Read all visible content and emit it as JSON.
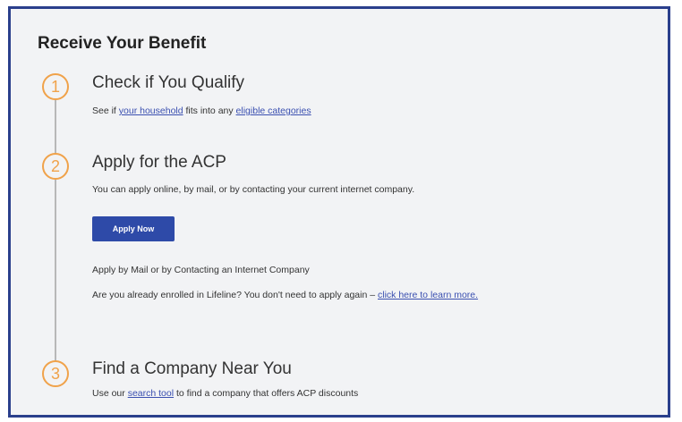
{
  "section": {
    "title": "Receive Your Benefit"
  },
  "steps": [
    {
      "number": "1",
      "title": "Check if You Qualify",
      "text_before": "See if ",
      "link1": "your household",
      "text_middle": " fits into any ",
      "link2": "eligible categories"
    },
    {
      "number": "2",
      "title": "Apply for the ACP",
      "description": "You can apply online, by mail, or by contacting your current internet company.",
      "button_label": "Apply Now",
      "mail_text": "Apply by Mail or by Contacting an Internet Company",
      "lifeline_text": "Are you already enrolled in Lifeline? You don't need to apply again – ",
      "lifeline_link": "click here to learn more."
    },
    {
      "number": "3",
      "title": "Find a Company Near You",
      "text_before": "Use our ",
      "link": "search tool",
      "text_after": " to find a company that offers ACP discounts"
    }
  ],
  "colors": {
    "frame_border": "#2a3f8c",
    "step_number": "#f0a24a",
    "link": "#3a4fb0",
    "button": "#2e4aa8"
  }
}
